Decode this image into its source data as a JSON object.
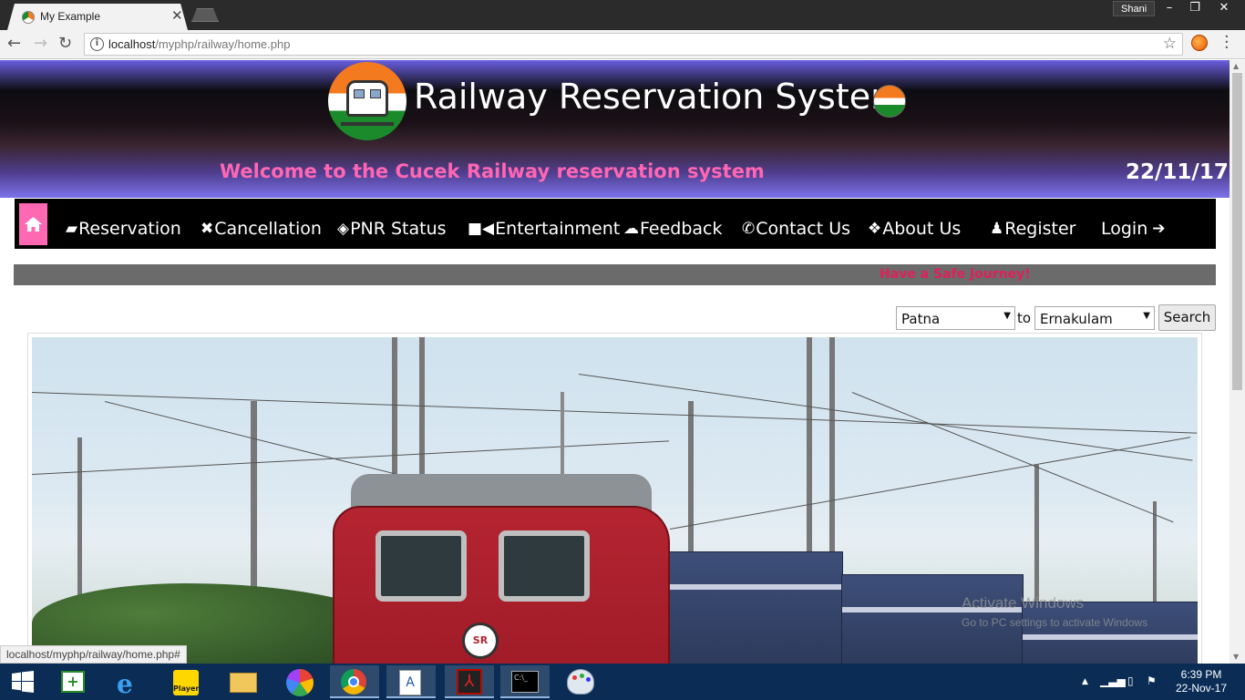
{
  "browser": {
    "tab_title": "My Example",
    "profile_name": "Shani",
    "url_host": "localhost",
    "url_path": "/myphp/railway/home.php",
    "status_url": "localhost/myphp/railway/home.php#"
  },
  "header": {
    "title": "Railway Reservation System",
    "welcome": "Welcome to the Cucek Railway reservation system",
    "date": "22/11/17"
  },
  "nav": {
    "items": [
      {
        "label": "Reservation",
        "icon": "book-icon"
      },
      {
        "label": "Cancellation",
        "icon": "x-icon"
      },
      {
        "label": "PNR Status",
        "icon": "ticket-icon"
      },
      {
        "label": "Entertainment",
        "icon": "video-icon"
      },
      {
        "label": "Feedback",
        "icon": "chat-icon"
      },
      {
        "label": "Contact Us",
        "icon": "phone-icon"
      },
      {
        "label": "About Us",
        "icon": "cubes-icon"
      },
      {
        "label": "Register",
        "icon": "user-plus-icon"
      },
      {
        "label": "Login",
        "icon": "sign-in-icon"
      }
    ]
  },
  "marquee": "Have a Safe Journey!",
  "search": {
    "from_value": "Patna",
    "to_label": "to",
    "to_value": "Ernakulam",
    "button": "Search"
  },
  "watermark": {
    "line1": "Activate Windows",
    "line2": "Go to PC settings to activate Windows"
  },
  "taskbar": {
    "time": "6:39 PM",
    "date": "22-Nov-17"
  },
  "colors": {
    "accent_pink": "#ff69b4",
    "welcome_pink": "#ff66b3",
    "marquee_red": "#e0205a"
  }
}
